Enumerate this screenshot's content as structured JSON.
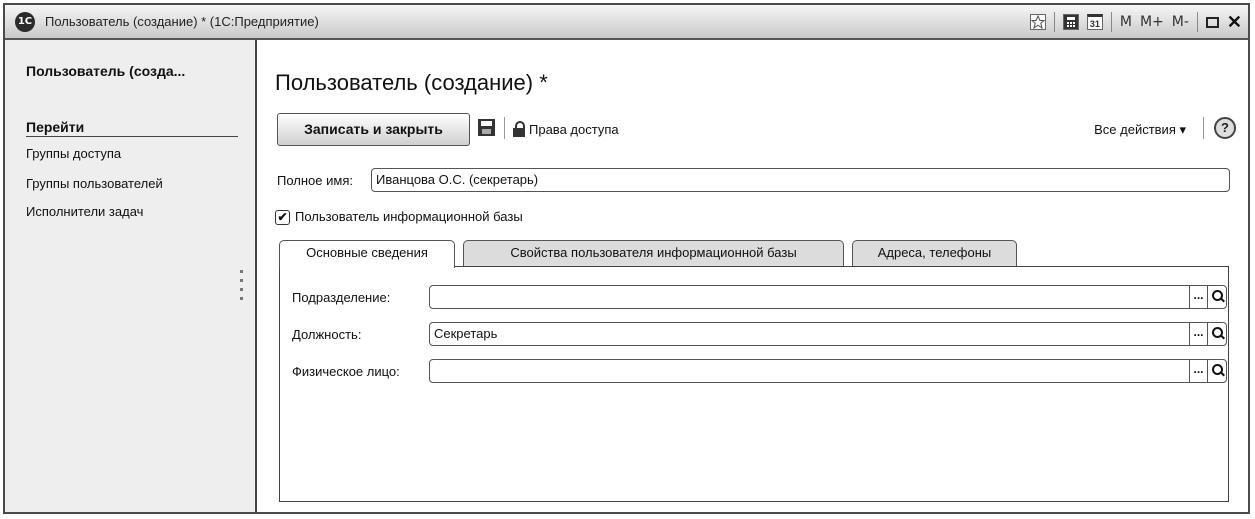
{
  "window": {
    "title": "Пользователь (создание) * (1С:Предприятие)",
    "logo": "1С",
    "toolbar": {
      "m": "M",
      "m_plus": "M+",
      "m_minus": "M-",
      "calendar_day": "31"
    }
  },
  "sidebar": {
    "title": "Пользователь (созда...",
    "section": "Перейти",
    "links": [
      "Группы доступа",
      "Группы пользователей",
      "Исполнители задач"
    ]
  },
  "form": {
    "title": "Пользователь (создание) *",
    "toolbar": {
      "write_close": "Записать и закрыть",
      "access_rights": "Права доступа",
      "all_actions": "Все действия ▾",
      "help": "?"
    },
    "full_name": {
      "label": "Полное имя:",
      "value": "Иванцова О.С. (секретарь)"
    },
    "ib_user": {
      "label": "Пользователь информационной базы",
      "checked": true,
      "check_glyph": "✔"
    },
    "tabs": [
      "Основные сведения",
      "Свойства пользователя информационной базы",
      "Адреса, телефоны"
    ],
    "active_tab": 0,
    "fields": [
      {
        "label": "Подразделение:",
        "value": ""
      },
      {
        "label": "Должность:",
        "value": "Секретарь"
      },
      {
        "label": "Физическое лицо:",
        "value": ""
      }
    ],
    "pick_glyph": "..."
  }
}
